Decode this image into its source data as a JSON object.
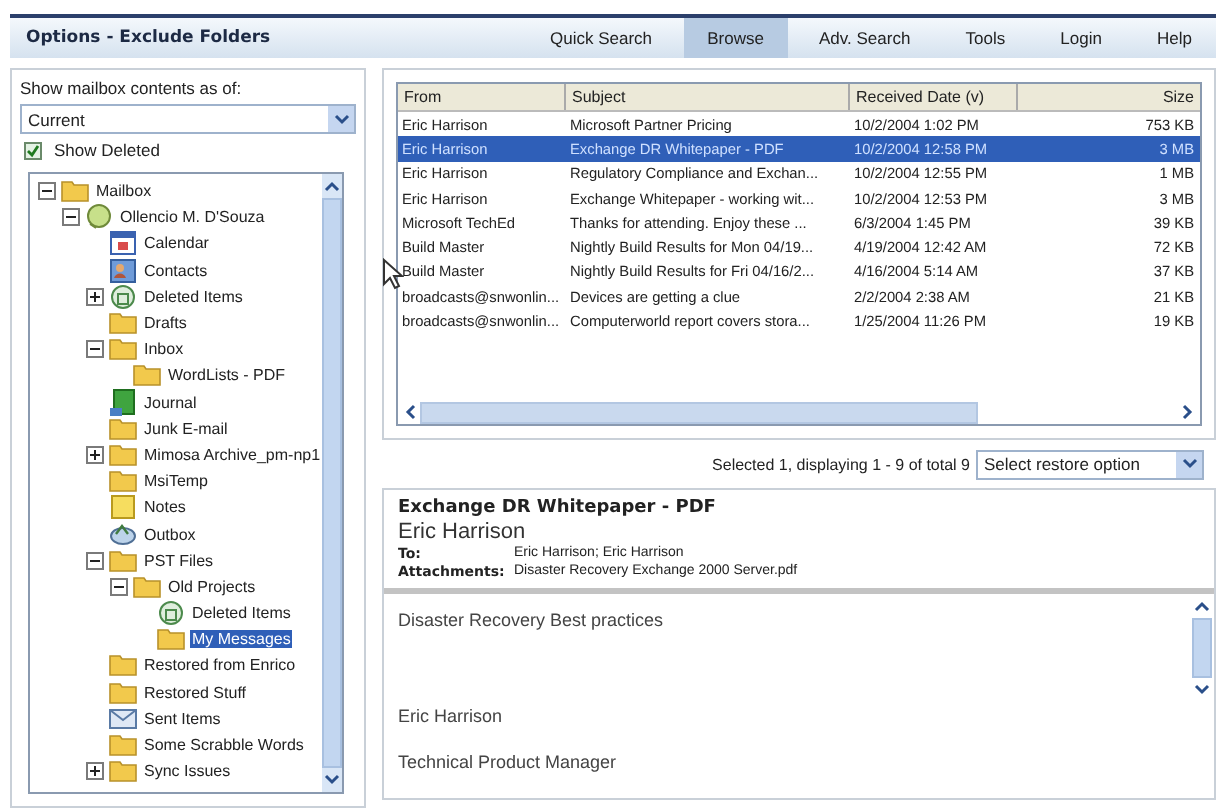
{
  "header": {
    "title": "Options - Exclude Folders",
    "nav": [
      {
        "label": "Quick Search",
        "selected": false
      },
      {
        "label": "Browse",
        "selected": true
      },
      {
        "label": "Adv. Search",
        "selected": false
      },
      {
        "label": "Tools",
        "selected": false
      },
      {
        "label": "Login",
        "selected": false
      },
      {
        "label": "Help",
        "selected": false
      }
    ]
  },
  "sidebar": {
    "contents_label": "Show mailbox contents as of:",
    "contents_value": "Current",
    "show_deleted": {
      "label": "Show Deleted",
      "checked": true
    },
    "tree": [
      {
        "label": "Mailbox",
        "kind": "folder",
        "expanded": true,
        "selected": false,
        "children": [
          {
            "label": "Ollencio M. D'Souza",
            "kind": "person",
            "expanded": true,
            "selected": false,
            "children": [
              {
                "label": "Calendar",
                "kind": "calendar",
                "selected": false
              },
              {
                "label": "Contacts",
                "kind": "contacts",
                "selected": false
              },
              {
                "label": "Deleted Items",
                "kind": "deleted",
                "expanded": false,
                "selected": false
              },
              {
                "label": "Drafts",
                "kind": "folder",
                "selected": false
              },
              {
                "label": "Inbox",
                "kind": "folder",
                "expanded": true,
                "selected": false,
                "children": [
                  {
                    "label": "WordLists - PDF",
                    "kind": "folder",
                    "selected": false
                  }
                ]
              },
              {
                "label": "Journal",
                "kind": "journal",
                "selected": false
              },
              {
                "label": "Junk E-mail",
                "kind": "folder",
                "selected": false
              },
              {
                "label": "Mimosa Archive_pm-np1",
                "kind": "folder",
                "expanded": false,
                "selected": false
              },
              {
                "label": "MsiTemp",
                "kind": "folder",
                "selected": false
              },
              {
                "label": "Notes",
                "kind": "notes",
                "selected": false
              },
              {
                "label": "Outbox",
                "kind": "outbox",
                "selected": false
              },
              {
                "label": "PST Files",
                "kind": "folder",
                "expanded": true,
                "selected": false,
                "children": [
                  {
                    "label": "Old Projects",
                    "kind": "folder",
                    "expanded": true,
                    "selected": false,
                    "children": [
                      {
                        "label": "Deleted Items",
                        "kind": "deleted",
                        "selected": false
                      },
                      {
                        "label": "My Messages",
                        "kind": "folder",
                        "selected": true
                      }
                    ]
                  }
                ]
              },
              {
                "label": "Restored from Enrico",
                "kind": "folder",
                "selected": false
              },
              {
                "label": "Restored Stuff",
                "kind": "folder",
                "selected": false
              },
              {
                "label": "Sent Items",
                "kind": "sent",
                "selected": false
              },
              {
                "label": "Some Scrabble Words",
                "kind": "folder",
                "selected": false
              },
              {
                "label": "Sync Issues",
                "kind": "folder",
                "expanded": false,
                "selected": false
              }
            ]
          }
        ]
      }
    ]
  },
  "table": {
    "columns": [
      "From",
      "Subject",
      "Received Date (v)",
      "Size"
    ],
    "rows": [
      {
        "cells": [
          "Eric Harrison",
          "Microsoft Partner Pricing",
          "10/2/2004 1:02 PM",
          "753 KB"
        ],
        "selected": false
      },
      {
        "cells": [
          "Eric Harrison",
          "Exchange DR Whitepaper - PDF",
          "10/2/2004 12:58 PM",
          "3 MB"
        ],
        "selected": true
      },
      {
        "cells": [
          "Eric Harrison",
          "Regulatory Compliance and Exchan...",
          "10/2/2004 12:55 PM",
          "1 MB"
        ],
        "selected": false
      },
      {
        "cells": [
          "Eric Harrison",
          "Exchange Whitepaper - working wit...",
          "10/2/2004 12:53 PM",
          "3 MB"
        ],
        "selected": false
      },
      {
        "cells": [
          "Microsoft TechEd",
          "Thanks for attending. Enjoy these ...",
          "6/3/2004 1:45 PM",
          "39 KB"
        ],
        "selected": false
      },
      {
        "cells": [
          "Build Master",
          "Nightly Build Results for Mon 04/19...",
          "4/19/2004 12:42 AM",
          "72 KB"
        ],
        "selected": false
      },
      {
        "cells": [
          "Build Master",
          "Nightly Build Results for Fri 04/16/2...",
          "4/16/2004 5:14 AM",
          "37 KB"
        ],
        "selected": false
      },
      {
        "cells": [
          "broadcasts@snwonlin...",
          "Devices are getting a clue",
          "2/2/2004 2:38 AM",
          "21 KB"
        ],
        "selected": false
      },
      {
        "cells": [
          "broadcasts@snwonlin...",
          "Computerworld report covers stora...",
          "1/25/2004 11:26 PM",
          "19 KB"
        ],
        "selected": false
      }
    ]
  },
  "status": "Selected 1, displaying 1 - 9 of total 9",
  "restore": {
    "placeholder": "Select restore option"
  },
  "preview": {
    "subject": "Exchange DR Whitepaper - PDF",
    "sender": "Eric Harrison",
    "fields": [
      {
        "label": "To:",
        "value": "Eric Harrison; Eric Harrison"
      },
      {
        "label": "Attachments:",
        "value": "Disaster Recovery Exchange 2000 Server.pdf"
      }
    ],
    "body": [
      "Disaster Recovery Best practices",
      "Eric Harrison",
      "Technical Product Manager"
    ]
  }
}
